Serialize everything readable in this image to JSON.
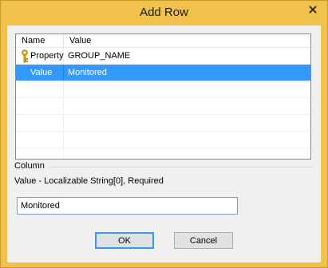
{
  "window": {
    "title": "Add Row"
  },
  "grid": {
    "columns": [
      "Name",
      "Value"
    ],
    "rows": [
      {
        "name": "Property",
        "value": "GROUP_NAME",
        "icon": "key-icon",
        "selected": false
      },
      {
        "name": "Value",
        "value": "Monitored",
        "icon": "",
        "selected": true
      },
      {
        "name": "",
        "value": "",
        "selected": false
      },
      {
        "name": "",
        "value": "",
        "selected": false
      },
      {
        "name": "",
        "value": "",
        "selected": false
      },
      {
        "name": "",
        "value": "",
        "selected": false
      },
      {
        "name": "",
        "value": "",
        "selected": false
      }
    ]
  },
  "column_group": {
    "title": "Column",
    "description": "Value - Localizable String[0], Required",
    "input_value": "Monitored"
  },
  "buttons": {
    "ok": "OK",
    "cancel": "Cancel"
  },
  "colors": {
    "title_bar": "#f0c24b",
    "selection": "#3399ff",
    "close_icon": "#1a1a1a"
  }
}
